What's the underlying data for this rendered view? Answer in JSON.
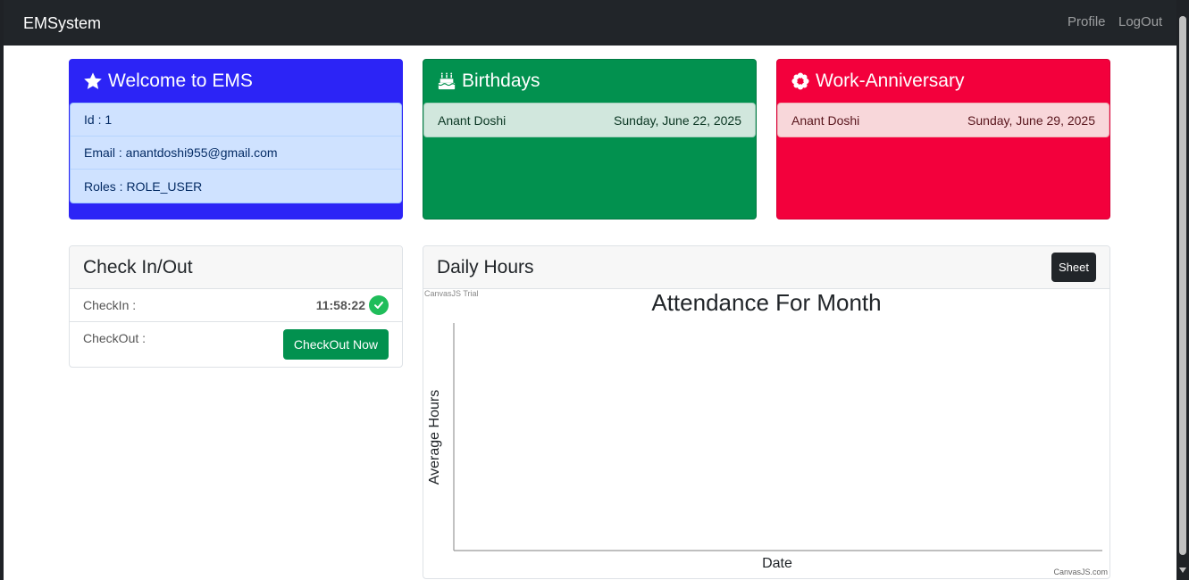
{
  "navbar": {
    "brand": "EMSystem",
    "links": {
      "profile": "Profile",
      "logout": "LogOut"
    }
  },
  "welcome": {
    "title": "Welcome to EMS",
    "icon": "star-icon",
    "color": "#2c24f6",
    "items": [
      {
        "label": "Id : 1"
      },
      {
        "label": "Email : anantdoshi955@gmail.com"
      },
      {
        "label": "Roles : ROLE_USER"
      }
    ]
  },
  "birthdays": {
    "title": "Birthdays",
    "icon": "cake-icon",
    "color": "#02914f",
    "items": [
      {
        "name": "Anant Doshi",
        "date": "Sunday, June 22, 2025"
      }
    ]
  },
  "anniversary": {
    "title": "Work-Anniversary",
    "icon": "flower-icon",
    "color": "#f3003c",
    "items": [
      {
        "name": "Anant Doshi",
        "date": "Sunday, June 29, 2025"
      }
    ]
  },
  "checkinout": {
    "title": "Check In/Out",
    "checkin_label": "CheckIn :",
    "checkin_time": "11:58:22",
    "checkin_status_icon": "check-circle-icon",
    "checkout_label": "CheckOut :",
    "checkout_button": "CheckOut Now"
  },
  "daily_hours": {
    "title": "Daily Hours",
    "sheet_button": "Sheet",
    "trial_watermark": "CanvasJS Trial",
    "credit": "CanvasJS.com"
  },
  "chart_data": {
    "type": "bar",
    "title": "Attendance For Month",
    "xlabel": "Date",
    "ylabel": "Average Hours",
    "categories": [],
    "values": [],
    "grid": false
  }
}
